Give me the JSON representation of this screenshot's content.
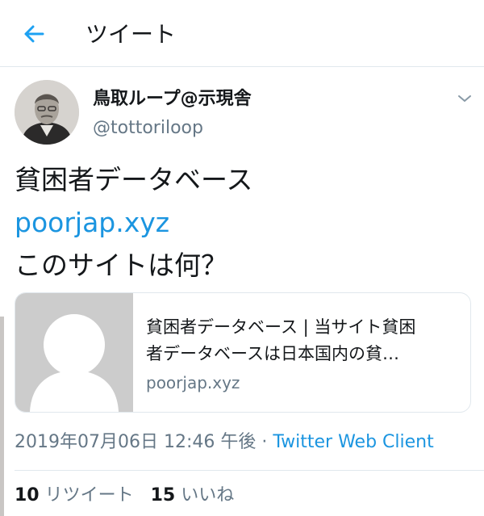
{
  "header": {
    "title": "ツイート",
    "back_icon": "arrow-left-icon"
  },
  "tweet": {
    "user": {
      "name": "鳥取ループ@示現舎",
      "handle": "@tottoriloop"
    },
    "text_lines": [
      "貧困者データベース",
      "poorjap.xyz",
      "このサイトは何？"
    ],
    "card": {
      "title_lines": [
        "貧困者データベース | 当サイト貧困",
        "者データベースは日本国内の貧…"
      ],
      "domain": "poorjap.xyz"
    },
    "meta": {
      "timestamp": "2019年07月06日 12:46 午後",
      "separator": " · ",
      "client": "Twitter Web Client"
    },
    "stats": {
      "retweets": {
        "count": "10",
        "label": "リツイート"
      },
      "likes": {
        "count": "15",
        "label": "いいね"
      }
    }
  },
  "colors": {
    "link": "#1b95e0",
    "secondary": "#657786",
    "text": "#14171a",
    "border": "#e1e8ed"
  }
}
